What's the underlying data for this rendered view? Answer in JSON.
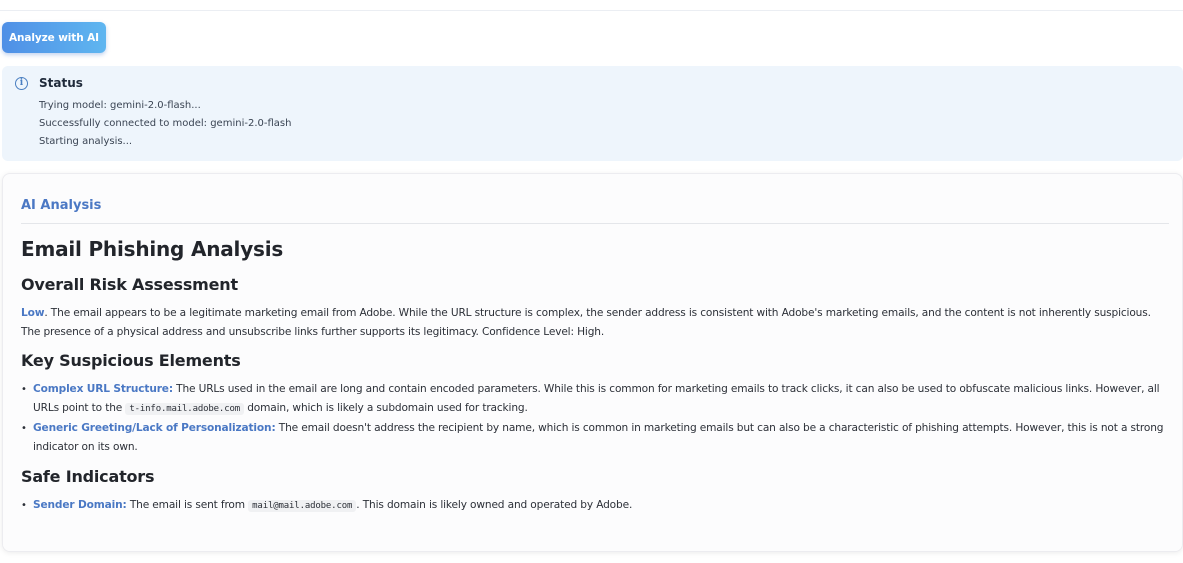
{
  "toolbar": {
    "analyze_label": "Analyze with AI"
  },
  "status": {
    "title": "Status",
    "icon": "info-circle-icon",
    "lines": [
      "Trying model: gemini-2.0-flash...",
      "Successfully connected to model: gemini-2.0-flash",
      "Starting analysis..."
    ]
  },
  "analysis": {
    "heading": "AI Analysis",
    "title": "Email Phishing Analysis",
    "risk": {
      "heading": "Overall Risk Assessment",
      "level": "Low",
      "text": ". The email appears to be a legitimate marketing email from Adobe. While the URL structure is complex, the sender address is consistent with Adobe's marketing emails, and the content is not inherently suspicious. The presence of a physical address and unsubscribe links further supports its legitimacy. Confidence Level: High."
    },
    "suspicious": {
      "heading": "Key Suspicious Elements",
      "items": [
        {
          "label": "Complex URL Structure:",
          "text_before": " The URLs used in the email are long and contain encoded parameters. While this is common for marketing emails to track clicks, it can also be used to obfuscate malicious links. However, all URLs point to the ",
          "code": "t-info.mail.adobe.com",
          "text_after": " domain, which is likely a subdomain used for tracking."
        },
        {
          "label": "Generic Greeting/Lack of Personalization:",
          "text_before": " The email doesn't address the recipient by name, which is common in marketing emails but can also be a characteristic of phishing attempts. However, this is not a strong indicator on its own.",
          "code": "",
          "text_after": ""
        }
      ]
    },
    "safe": {
      "heading": "Safe Indicators",
      "items": [
        {
          "label": "Sender Domain:",
          "text_before": " The email is sent from ",
          "code": "mail@mail.adobe.com",
          "text_after": ". This domain is likely owned and operated by Adobe."
        }
      ]
    }
  },
  "colors": {
    "accent": "#4b78c4",
    "button_start": "#4f8fe6",
    "button_end": "#5fb6f0",
    "status_bg": "#eef5fc"
  }
}
